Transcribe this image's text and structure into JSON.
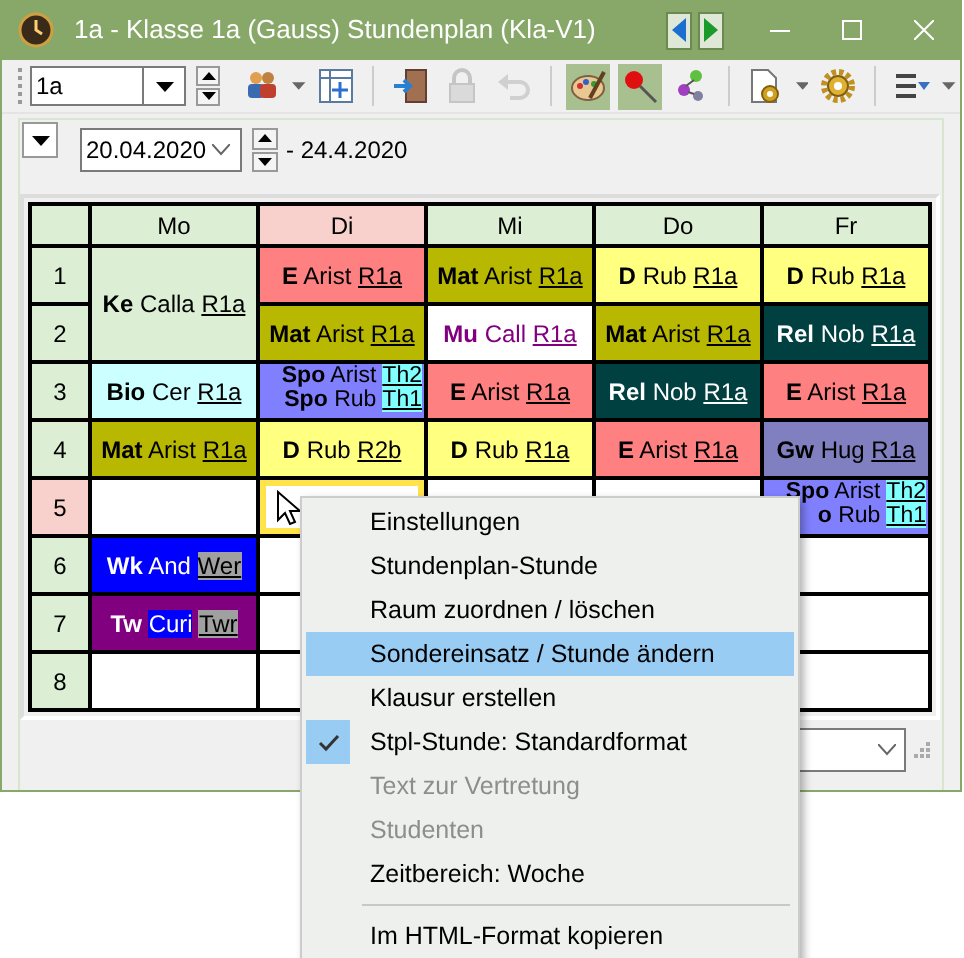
{
  "window": {
    "title": "1a - Klasse 1a (Gauss)  Stundenplan  (Kla-V1)"
  },
  "toolbar": {
    "class_value": "1a",
    "buttons": [
      {
        "kind": "people",
        "pressed": false,
        "disabled": false,
        "caret": true
      },
      {
        "kind": "table",
        "pressed": false,
        "disabled": false,
        "caret": false
      },
      {
        "kind": "sep"
      },
      {
        "kind": "door",
        "pressed": false,
        "disabled": false,
        "caret": false
      },
      {
        "kind": "lock",
        "pressed": false,
        "disabled": true,
        "caret": false
      },
      {
        "kind": "undo",
        "pressed": false,
        "disabled": true,
        "caret": false
      },
      {
        "kind": "sep"
      },
      {
        "kind": "palette",
        "pressed": true,
        "disabled": false,
        "caret": false
      },
      {
        "kind": "pin",
        "pressed": true,
        "disabled": false,
        "caret": false
      },
      {
        "kind": "nodes",
        "pressed": false,
        "disabled": false,
        "caret": false
      },
      {
        "kind": "sep"
      },
      {
        "kind": "docgear",
        "pressed": false,
        "disabled": false,
        "caret": true
      },
      {
        "kind": "gear",
        "pressed": false,
        "disabled": false,
        "caret": false
      },
      {
        "kind": "sep"
      },
      {
        "kind": "list",
        "pressed": false,
        "disabled": false,
        "caret": true
      }
    ]
  },
  "date_bar": {
    "date": "20.04.2020",
    "range_end": "- 24.4.2020"
  },
  "timetable": {
    "days": [
      {
        "label": "Mo",
        "highlighted": false
      },
      {
        "label": "Di",
        "highlighted": true
      },
      {
        "label": "Mi",
        "highlighted": false
      },
      {
        "label": "Do",
        "highlighted": false
      },
      {
        "label": "Fr",
        "highlighted": false
      }
    ],
    "periods": [
      {
        "label": "1",
        "highlighted": false,
        "cells": [
          {
            "kind": "double",
            "color": "#dcefd4",
            "entries": [
              {
                "subject": "Ke",
                "teacher": "Calla",
                "room": "R1a"
              }
            ]
          },
          {
            "kind": "single",
            "color": "#ff8080",
            "entries": [
              {
                "subject": "E",
                "teacher": "Arist",
                "room": "R1a"
              }
            ]
          },
          {
            "kind": "single",
            "color": "#b8b800",
            "entries": [
              {
                "subject": "Mat",
                "teacher": "Arist",
                "room": "R1a"
              }
            ]
          },
          {
            "kind": "single",
            "color": "#ffff80",
            "entries": [
              {
                "subject": "D",
                "teacher": "Rub",
                "room": "R1a"
              }
            ]
          },
          {
            "kind": "single",
            "color": "#ffff80",
            "entries": [
              {
                "subject": "D",
                "teacher": "Rub",
                "room": "R1a"
              }
            ]
          }
        ]
      },
      {
        "label": "2",
        "highlighted": false,
        "cells": [
          {
            "kind": "single",
            "color": "#b8b800",
            "entries": [
              {
                "subject": "Mat",
                "teacher": "Arist",
                "room": "R1a"
              }
            ]
          },
          {
            "kind": "single",
            "color": "#ffffff",
            "ink": {
              "color": "#800080"
            },
            "entries": [
              {
                "subject": "Mu",
                "teacher": "Call",
                "room": "R1a"
              }
            ]
          },
          {
            "kind": "single",
            "color": "#b8b800",
            "entries": [
              {
                "subject": "Mat",
                "teacher": "Arist",
                "room": "R1a"
              }
            ]
          },
          {
            "kind": "single",
            "color": "#004040",
            "entries": [
              {
                "subject": "Rel",
                "teacher": "Nob",
                "room": "R1a"
              }
            ]
          }
        ]
      },
      {
        "label": "3",
        "highlighted": false,
        "cells": [
          {
            "kind": "single",
            "color": "#ccffff",
            "entries": [
              {
                "subject": "Bio",
                "teacher": "Cer",
                "room": "R1a"
              }
            ]
          },
          {
            "kind": "single",
            "color": "#8080ff",
            "entries": [
              {
                "subject": "Spo",
                "teacher": "Arist",
                "room": "Th2",
                "room_mark": {
                  "color": "#80ffff"
                }
              },
              {
                "subject": "Spo",
                "teacher": "Rub",
                "room": "Th1",
                "room_mark": {
                  "color": "#80ffff"
                }
              }
            ]
          },
          {
            "kind": "single",
            "color": "#ff8080",
            "entries": [
              {
                "subject": "E",
                "teacher": "Arist",
                "room": "R1a"
              }
            ]
          },
          {
            "kind": "single",
            "color": "#004040",
            "entries": [
              {
                "subject": "Rel",
                "teacher": "Nob",
                "room": "R1a"
              }
            ]
          },
          {
            "kind": "single",
            "color": "#ff8080",
            "entries": [
              {
                "subject": "E",
                "teacher": "Arist",
                "room": "R1a"
              }
            ]
          }
        ]
      },
      {
        "label": "4",
        "highlighted": false,
        "cells": [
          {
            "kind": "single",
            "color": "#b8b800",
            "entries": [
              {
                "subject": "Mat",
                "teacher": "Arist",
                "room": "R1a"
              }
            ]
          },
          {
            "kind": "single",
            "color": "#ffff80",
            "entries": [
              {
                "subject": "D",
                "teacher": "Rub",
                "room": "R2b"
              }
            ]
          },
          {
            "kind": "single",
            "color": "#ffff80",
            "entries": [
              {
                "subject": "D",
                "teacher": "Rub",
                "room": "R1a"
              }
            ]
          },
          {
            "kind": "single",
            "color": "#ff8080",
            "entries": [
              {
                "subject": "E",
                "teacher": "Arist",
                "room": "R1a"
              }
            ]
          },
          {
            "kind": "single",
            "color": "#8080c0",
            "entries": [
              {
                "subject": "Gw",
                "teacher": "Hug",
                "room": "R1a"
              }
            ]
          }
        ]
      },
      {
        "label": "5",
        "highlighted": true,
        "cells": [
          {
            "kind": "empty"
          },
          {
            "kind": "selected"
          },
          {
            "kind": "empty"
          },
          {
            "kind": "empty"
          },
          {
            "kind": "single",
            "color": "#8080ff",
            "entries": [
              {
                "subject": "Spo",
                "teacher": "Arist",
                "room": "Th2",
                "room_mark": {
                  "color": "#80ffff"
                }
              },
              {
                "subject": "o",
                "teacher": "Rub",
                "room": "Th1",
                "room_mark": {
                  "color": "#80ffff"
                }
              }
            ]
          }
        ]
      },
      {
        "label": "6",
        "highlighted": false,
        "cells": [
          {
            "kind": "single",
            "color": "#0000ff",
            "entries": [
              {
                "subject": "Wk",
                "teacher": "And",
                "room": "Wer",
                "room_mark": {
                  "color": "#a0a0a0"
                }
              }
            ]
          },
          {
            "kind": "empty"
          },
          {
            "kind": "empty"
          },
          {
            "kind": "empty"
          },
          {
            "kind": "empty"
          }
        ]
      },
      {
        "label": "7",
        "highlighted": false,
        "cells": [
          {
            "kind": "single",
            "color": "#800080",
            "entries": [
              {
                "subject": "Tw",
                "teacher": "Curi",
                "room": "Twr",
                "teacher_mark": {
                  "color": "#0000ff"
                },
                "room_mark": {
                  "color": "#a0a0a0"
                }
              }
            ]
          },
          {
            "kind": "empty"
          },
          {
            "kind": "empty"
          },
          {
            "kind": "empty"
          },
          {
            "kind": "empty"
          }
        ]
      },
      {
        "label": "8",
        "highlighted": false,
        "cells": [
          {
            "kind": "empty"
          },
          {
            "kind": "empty"
          },
          {
            "kind": "empty"
          },
          {
            "kind": "empty"
          },
          {
            "kind": "empty"
          }
        ]
      }
    ]
  },
  "context_menu": {
    "items": [
      {
        "kind": "item",
        "label": "Einstellungen",
        "selected": false,
        "checked": false,
        "disabled": false
      },
      {
        "kind": "item",
        "label": "Stundenplan-Stunde",
        "selected": false,
        "checked": false,
        "disabled": false
      },
      {
        "kind": "item",
        "label": "Raum zuordnen / löschen",
        "selected": false,
        "checked": false,
        "disabled": false
      },
      {
        "kind": "item",
        "label": "Sondereinsatz / Stunde ändern",
        "selected": true,
        "checked": false,
        "disabled": false
      },
      {
        "kind": "item",
        "label": "Klausur erstellen",
        "selected": false,
        "checked": false,
        "disabled": false
      },
      {
        "kind": "item",
        "label": "Stpl-Stunde: Standardformat",
        "selected": false,
        "checked": true,
        "disabled": false
      },
      {
        "kind": "item",
        "label": "Text zur Vertretung",
        "selected": false,
        "checked": false,
        "disabled": true
      },
      {
        "kind": "item",
        "label": "Studenten",
        "selected": false,
        "checked": false,
        "disabled": true
      },
      {
        "kind": "item",
        "label": "Zeitbereich: Woche",
        "selected": false,
        "checked": false,
        "disabled": false
      },
      {
        "kind": "separator"
      },
      {
        "kind": "item",
        "label": "Im HTML-Format kopieren",
        "selected": false,
        "checked": false,
        "disabled": false
      }
    ]
  }
}
